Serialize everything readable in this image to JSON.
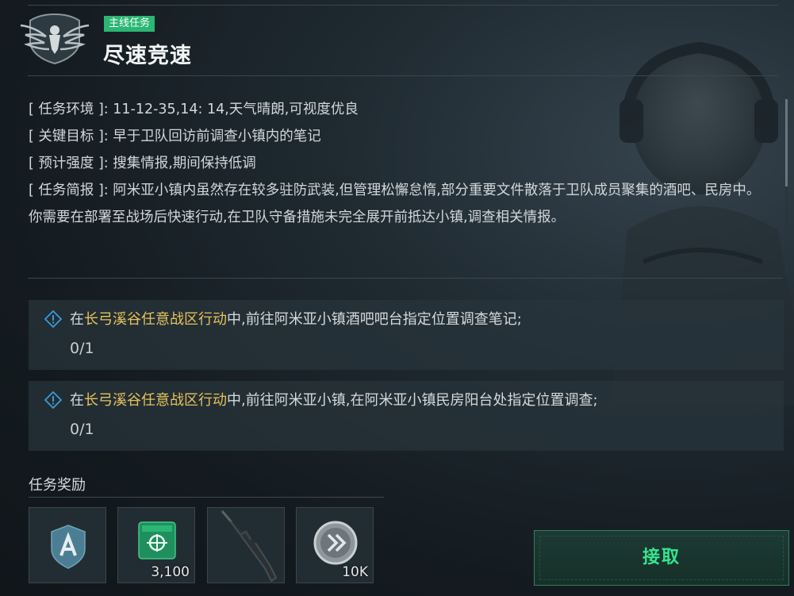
{
  "mission": {
    "badge": "主线任务",
    "title": "尽速竞速",
    "emblem_icon": "eagle-emblem-icon"
  },
  "info": {
    "environment": {
      "label": "[ 任务环境 ]",
      "value": ": 11-12-35,14: 14,天气晴朗,可视度优良"
    },
    "target": {
      "label": "[ 关键目标 ]",
      "value": ": 早于卫队回访前调查小镇内的笔记"
    },
    "intensity": {
      "label": "[ 预计强度 ]",
      "value": ": 搜集情报,期间保持低调"
    },
    "briefing": {
      "label": "[ 任务简报 ]",
      "value": ": 阿米亚小镇内虽然存在较多驻防武装,但管理松懈怠惰,部分重要文件散落于卫队成员聚集的酒吧、民房中。你需要在部署至战场后快速行动,在卫队守备措施未完全展开前抵达小镇,调查相关情报。"
    }
  },
  "objectives": [
    {
      "prefix": "在",
      "highlight": "长弓溪谷任意战区行动",
      "suffix": "中,前往阿米亚小镇酒吧吧台指定位置调查笔记;",
      "progress": "0/1"
    },
    {
      "prefix": "在",
      "highlight": "长弓溪谷任意战区行动",
      "suffix": "中,前往阿米亚小镇,在阿米亚小镇民房阳台处指定位置调查;",
      "progress": "0/1"
    }
  ],
  "rewards": {
    "label": "任务奖励",
    "items": [
      {
        "icon": "shield-emblem-icon",
        "count": ""
      },
      {
        "icon": "supply-crate-icon",
        "count": "3,100"
      },
      {
        "icon": "rifle-icon",
        "count": ""
      },
      {
        "icon": "silver-coin-icon",
        "count": "10K"
      }
    ]
  },
  "actions": {
    "accept_label": "接取"
  },
  "colors": {
    "badge": "#2bb673",
    "highlight": "#e7c25a",
    "accept": "#36e48f"
  }
}
